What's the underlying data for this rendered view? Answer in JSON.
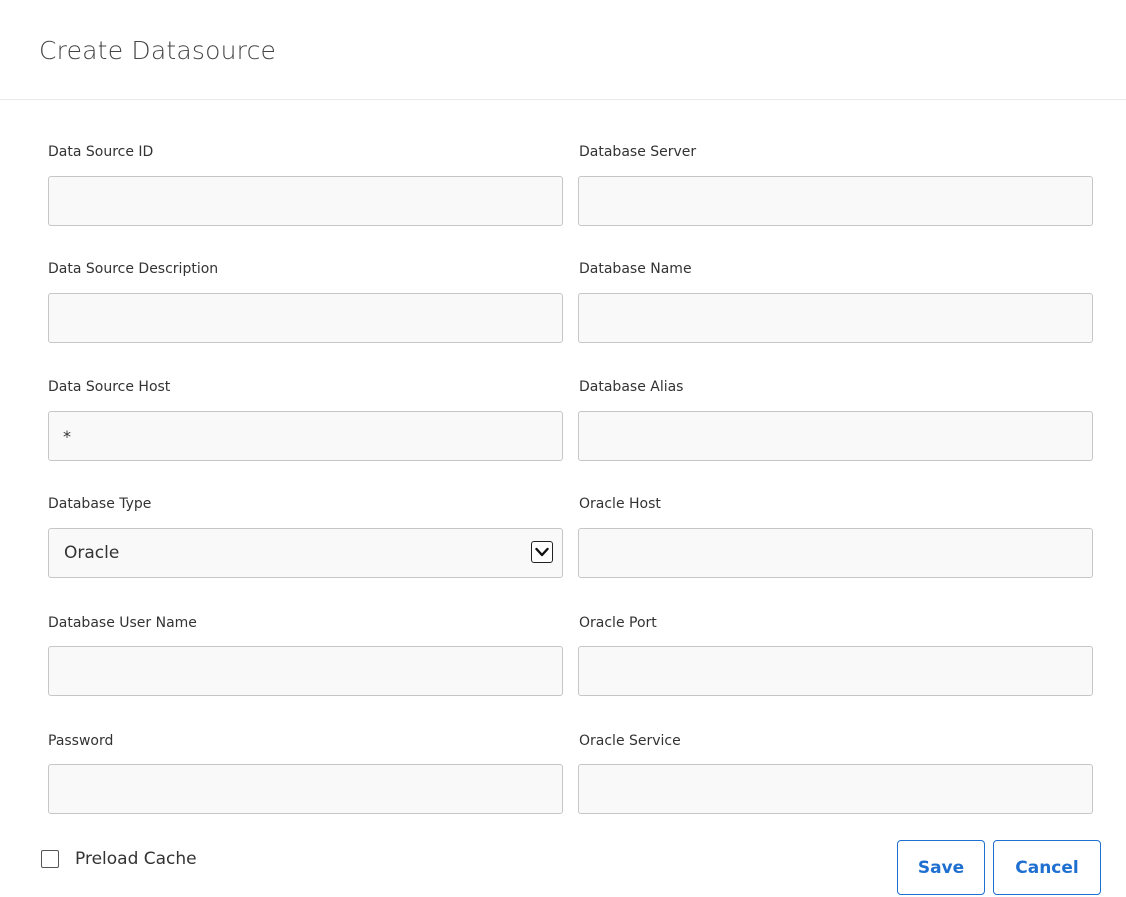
{
  "dialog": {
    "title": "Create Datasource"
  },
  "fields": {
    "data_source_id": {
      "label": "Data Source ID",
      "value": ""
    },
    "data_source_description": {
      "label": "Data Source Description",
      "value": ""
    },
    "data_source_host": {
      "label": "Data Source Host",
      "value": "*"
    },
    "database_type": {
      "label": "Database Type",
      "value": "Oracle"
    },
    "database_user_name": {
      "label": "Database User Name",
      "value": ""
    },
    "password": {
      "label": "Password",
      "value": ""
    },
    "database_server": {
      "label": "Database Server",
      "value": ""
    },
    "database_name": {
      "label": "Database Name",
      "value": ""
    },
    "database_alias": {
      "label": "Database Alias",
      "value": ""
    },
    "oracle_host": {
      "label": "Oracle Host",
      "value": ""
    },
    "oracle_port": {
      "label": "Oracle Port",
      "value": ""
    },
    "oracle_service": {
      "label": "Oracle Service",
      "value": ""
    }
  },
  "preload_cache": {
    "label": "Preload Cache",
    "checked": false
  },
  "buttons": {
    "save_label": "Save",
    "cancel_label": "Cancel"
  },
  "colors": {
    "accent": "#1e6fd0",
    "input_border": "#c6c6c6",
    "input_background": "#f9f9f9"
  },
  "icons": {
    "select_arrow": "chevron-down-icon",
    "checkbox": "checkbox-unchecked-icon"
  }
}
